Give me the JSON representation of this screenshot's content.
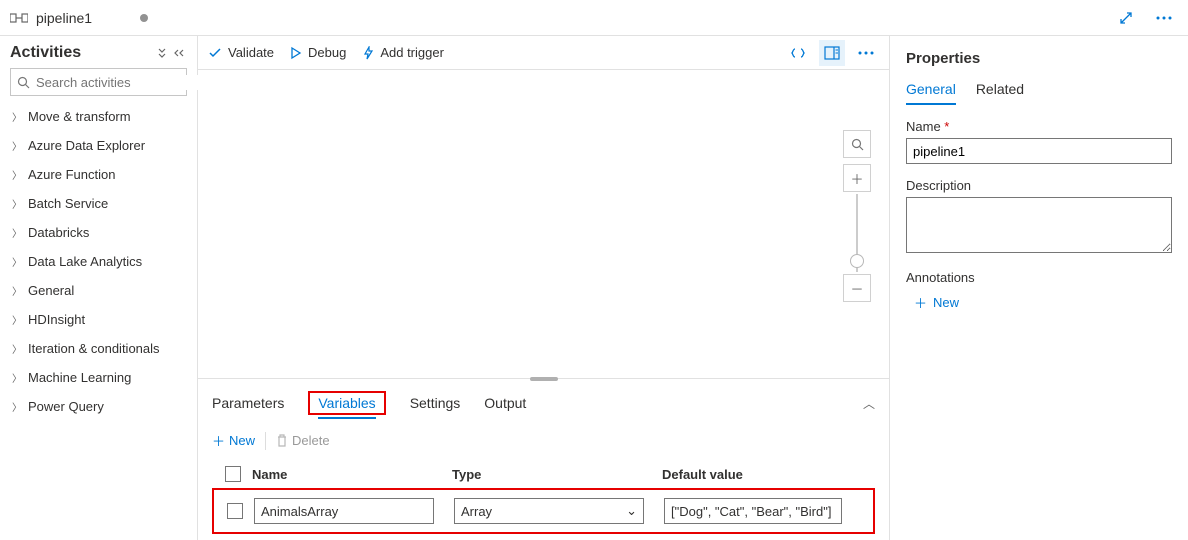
{
  "title": "pipeline1",
  "activities": {
    "title": "Activities",
    "search_placeholder": "Search activities",
    "items": [
      "Move & transform",
      "Azure Data Explorer",
      "Azure Function",
      "Batch Service",
      "Databricks",
      "Data Lake Analytics",
      "General",
      "HDInsight",
      "Iteration & conditionals",
      "Machine Learning",
      "Power Query"
    ]
  },
  "toolbar": {
    "validate": "Validate",
    "debug": "Debug",
    "trigger": "Add trigger"
  },
  "bottom_tabs": {
    "parameters": "Parameters",
    "variables": "Variables",
    "settings": "Settings",
    "output": "Output"
  },
  "vars_toolbar": {
    "new": "New",
    "delete": "Delete"
  },
  "vars_head": {
    "name": "Name",
    "type": "Type",
    "default": "Default value"
  },
  "vars_row": {
    "name": "AnimalsArray",
    "type": "Array",
    "default": "[\"Dog\", \"Cat\", \"Bear\", \"Bird\"]"
  },
  "properties": {
    "title": "Properties",
    "tab_general": "General",
    "tab_related": "Related",
    "name_label": "Name ",
    "name_value": "pipeline1",
    "desc_label": "Description",
    "ann_label": "Annotations",
    "ann_new": "New"
  }
}
